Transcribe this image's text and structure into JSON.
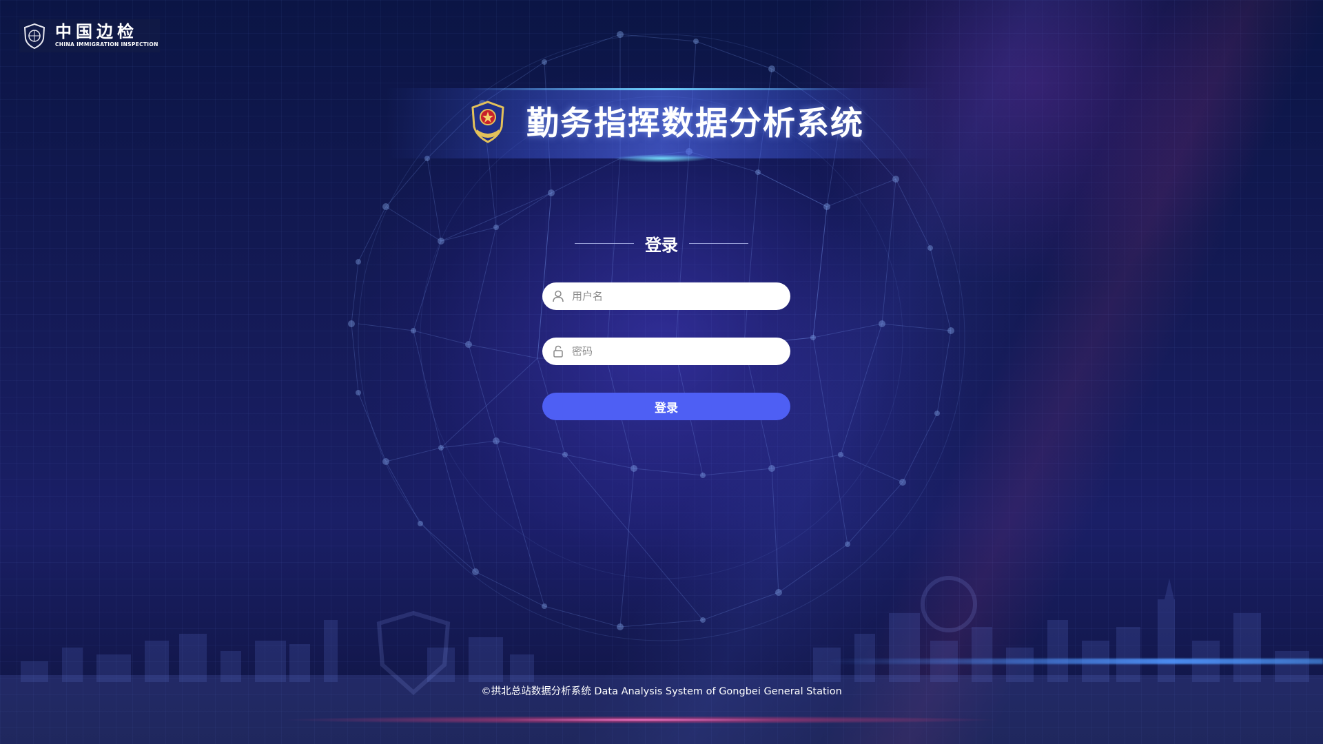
{
  "brand": {
    "name_cn": "中国边检",
    "name_en": "CHINA IMMIGRATION INSPECTION"
  },
  "header": {
    "title": "勤务指挥数据分析系统"
  },
  "login": {
    "heading": "登录",
    "username_placeholder": "用户名",
    "password_placeholder": "密码",
    "submit_label": "登录"
  },
  "footer": {
    "copyright": "©拱北总站数据分析系统 Data Analysis System of Gongbei General Station"
  },
  "icons": {
    "brand": "immigration-emblem-icon",
    "title": "police-emblem-icon",
    "username": "user-icon",
    "password": "lock-icon"
  },
  "colors": {
    "background": "#141a55",
    "button": "#4e5ff4",
    "input_background": "#ffffff",
    "text": "#ffffff"
  }
}
